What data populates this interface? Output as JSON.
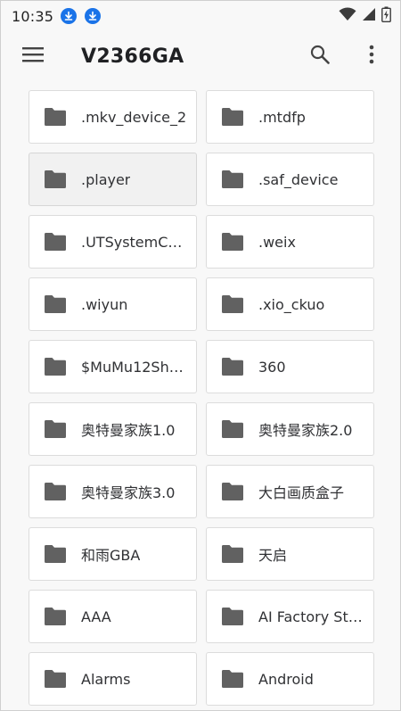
{
  "status_bar": {
    "time": "10:35",
    "download_icons": [
      "download-badge-icon",
      "download-badge-icon"
    ]
  },
  "toolbar": {
    "title": "V2366GA",
    "menu_icon": "hamburger-menu-icon",
    "search_icon": "search-icon",
    "more_icon": "more-vert-icon"
  },
  "colors": {
    "background": "#f8f8f8",
    "tile": "#ffffff",
    "tile_pressed": "#f1f1f1",
    "folder": "#616161",
    "accent": "#1a73e8"
  },
  "folders": [
    {
      "name": ".mkv_device_2",
      "pressed": false
    },
    {
      "name": ".mtdfp",
      "pressed": false
    },
    {
      "name": ".player",
      "pressed": true
    },
    {
      "name": ".saf_device",
      "pressed": false
    },
    {
      "name": ".UTSystemC…",
      "pressed": false
    },
    {
      "name": ".weix",
      "pressed": false
    },
    {
      "name": ".wiyun",
      "pressed": false
    },
    {
      "name": ".xio_ckuo",
      "pressed": false
    },
    {
      "name": "$MuMu12Sh…",
      "pressed": false
    },
    {
      "name": "360",
      "pressed": false
    },
    {
      "name": "奥特曼家族1.0",
      "pressed": false
    },
    {
      "name": "奥特曼家族2.0",
      "pressed": false
    },
    {
      "name": "奥特曼家族3.0",
      "pressed": false
    },
    {
      "name": "大白画质盒子",
      "pressed": false
    },
    {
      "name": "和雨GBA",
      "pressed": false
    },
    {
      "name": "天启",
      "pressed": false
    },
    {
      "name": "AAA",
      "pressed": false
    },
    {
      "name": "AI Factory St…",
      "pressed": false
    },
    {
      "name": "Alarms",
      "pressed": false
    },
    {
      "name": "Android",
      "pressed": false
    }
  ]
}
